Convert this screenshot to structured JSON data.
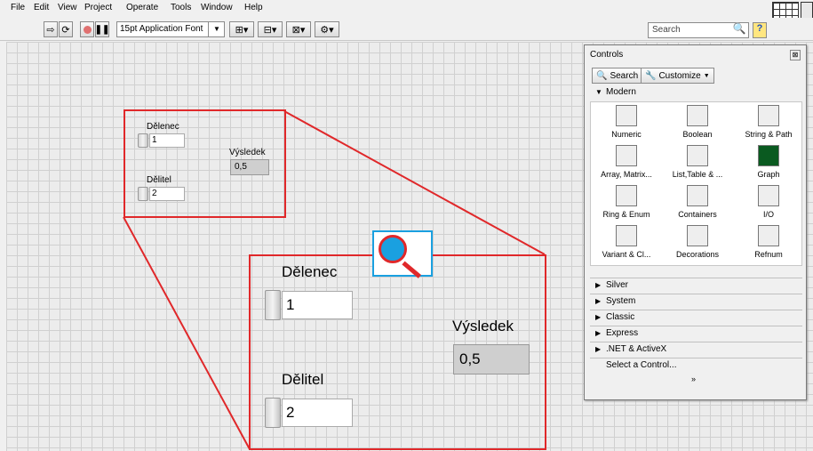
{
  "menu": [
    "File",
    "Edit",
    "View",
    "Project",
    "Operate",
    "Tools",
    "Window",
    "Help"
  ],
  "toolbar": {
    "font": "15pt Application Font",
    "search_placeholder": "Search",
    "help": "?"
  },
  "front_panel": {
    "small": {
      "delenec_label": "Dělenec",
      "delenec_value": "1",
      "delitel_label": "Dělitel",
      "delitel_value": "2",
      "vysledek_label": "Výsledek",
      "vysledek_value": "0,5"
    },
    "zoom": {
      "delenec_label": "Dělenec",
      "delenec_value": "1",
      "delitel_label": "Dělitel",
      "delitel_value": "2",
      "vysledek_label": "Výsledek",
      "vysledek_value": "0,5"
    }
  },
  "palette": {
    "title": "Controls",
    "search": "Search",
    "customize": "Customize",
    "modern": "Modern",
    "items": [
      "Numeric",
      "Boolean",
      "String & Path",
      "Array, Matrix...",
      "List,Table & ...",
      "Graph",
      "Ring & Enum",
      "Containers",
      "I/O",
      "Variant & Cl...",
      "Decorations",
      "Refnum"
    ],
    "categories": [
      "Silver",
      "System",
      "Classic",
      "Express",
      ".NET & ActiveX"
    ],
    "select": "Select a Control..."
  },
  "colors": {
    "highlight": "#e0282a",
    "zoom_icon": "#1aa0e0"
  }
}
